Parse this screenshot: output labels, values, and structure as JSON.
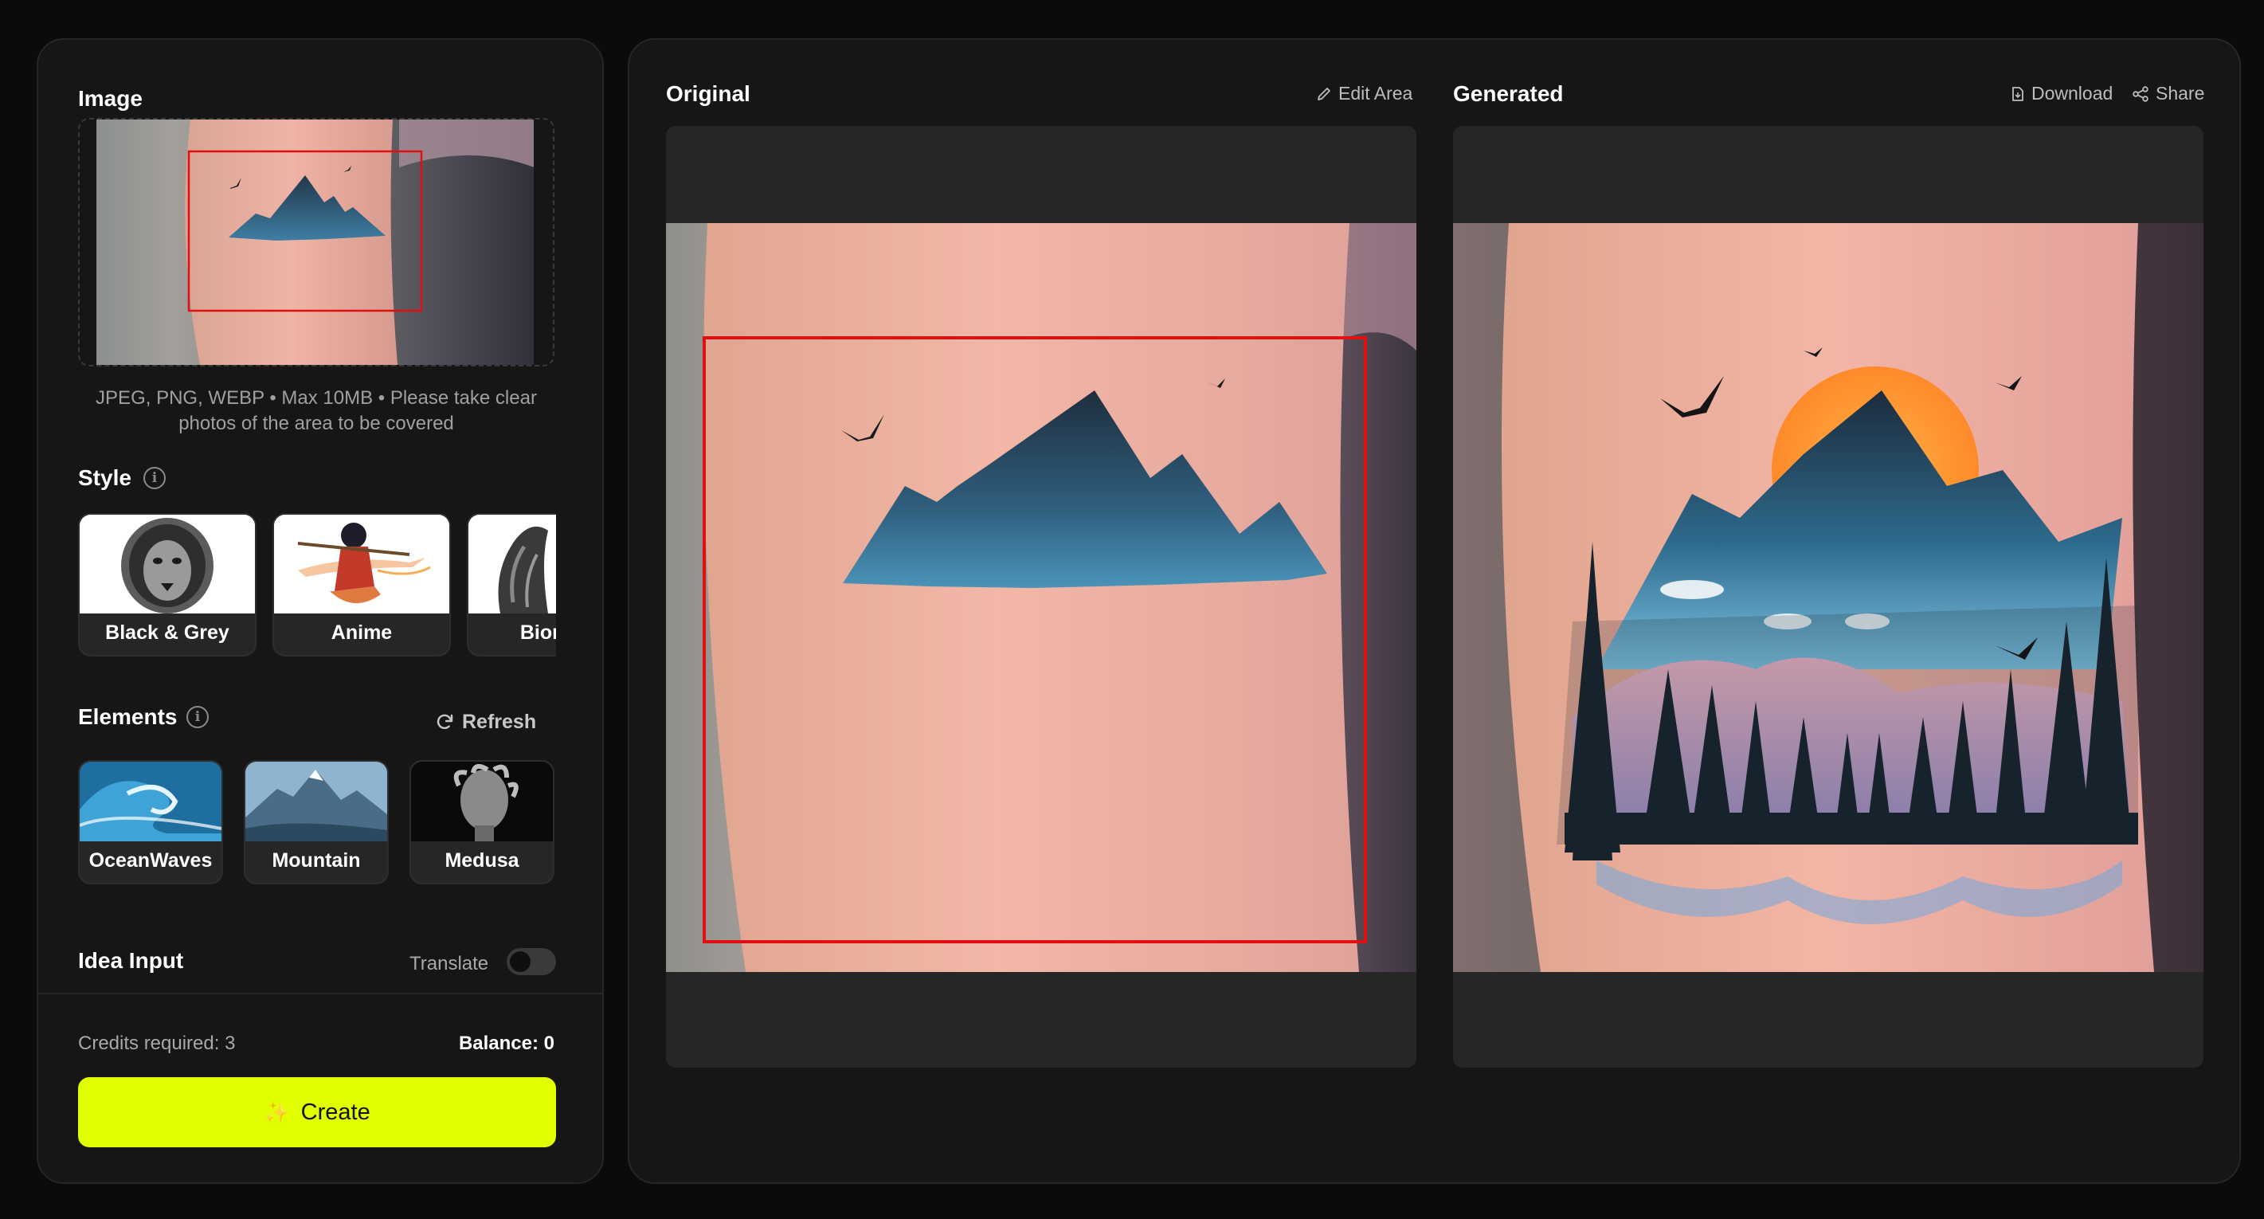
{
  "left": {
    "image_title": "Image",
    "upload_hint": "JPEG, PNG, WEBP • Max 10MB • Please take clear photos of the area to be covered",
    "style_title": "Style",
    "styles": [
      {
        "label": "Black & Grey"
      },
      {
        "label": "Anime"
      },
      {
        "label": "Biomec"
      }
    ],
    "elements_title": "Elements",
    "refresh_label": "Refresh",
    "elements": [
      {
        "label": "OceanWaves"
      },
      {
        "label": "Mountain"
      },
      {
        "label": "Medusa"
      }
    ],
    "idea_title": "Idea Input",
    "translate_label": "Translate",
    "translate_on": false,
    "credits_label": "Credits required: 3",
    "balance_label": "Balance: 0",
    "create_label": "Create"
  },
  "right": {
    "original_title": "Original",
    "edit_area_label": "Edit Area",
    "generated_title": "Generated",
    "download_label": "Download",
    "share_label": "Share"
  },
  "colors": {
    "accent": "#e2ff00",
    "selection": "#e01010",
    "panel": "#161616",
    "card": "#262626"
  }
}
